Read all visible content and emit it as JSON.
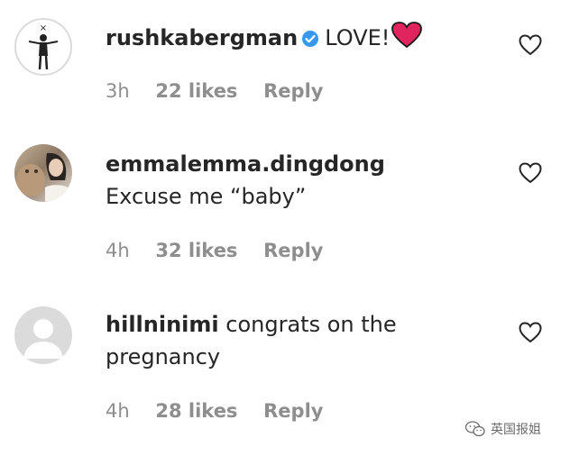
{
  "comments": [
    {
      "username": "rushkabergman",
      "verified": true,
      "text": "LOVE!",
      "emoji": "red-heart",
      "time": "3h",
      "likes": "22 likes",
      "reply": "Reply"
    },
    {
      "username": "emmalemma.dingdong",
      "verified": false,
      "text": "Excuse me “baby”",
      "time": "4h",
      "likes": "32 likes",
      "reply": "Reply"
    },
    {
      "username": "hillninimi",
      "verified": false,
      "text": "congrats on the pregnancy",
      "time": "4h",
      "likes": "28 likes",
      "reply": "Reply"
    }
  ],
  "watermark": {
    "text": "英国报姐",
    "icon": "wechat-icon"
  },
  "colors": {
    "verified": "#3897f0",
    "heart": "#e0245e",
    "meta": "#8e8e8e",
    "text": "#262626"
  }
}
